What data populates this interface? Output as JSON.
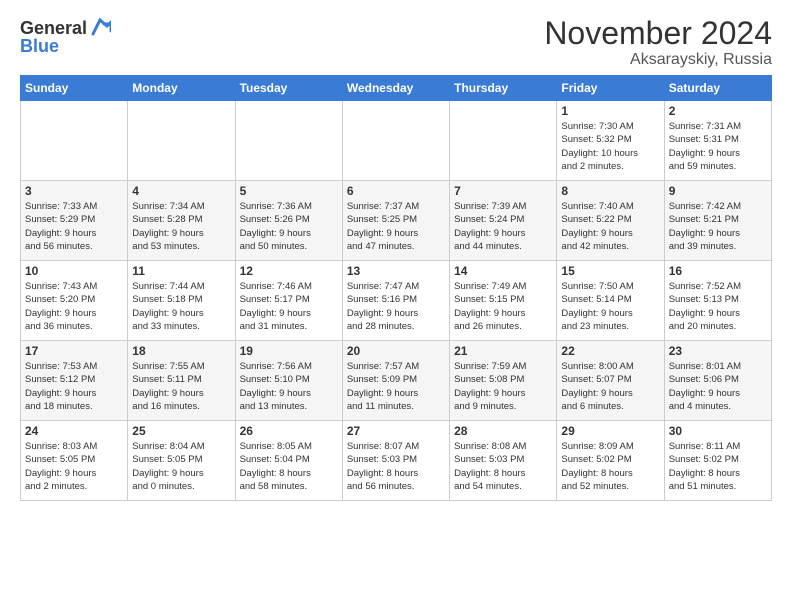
{
  "logo": {
    "general": "General",
    "blue": "Blue"
  },
  "header": {
    "month": "November 2024",
    "location": "Aksarayskiy, Russia"
  },
  "weekdays": [
    "Sunday",
    "Monday",
    "Tuesday",
    "Wednesday",
    "Thursday",
    "Friday",
    "Saturday"
  ],
  "weeks": [
    [
      {
        "day": "",
        "info": ""
      },
      {
        "day": "",
        "info": ""
      },
      {
        "day": "",
        "info": ""
      },
      {
        "day": "",
        "info": ""
      },
      {
        "day": "",
        "info": ""
      },
      {
        "day": "1",
        "info": "Sunrise: 7:30 AM\nSunset: 5:32 PM\nDaylight: 10 hours\nand 2 minutes."
      },
      {
        "day": "2",
        "info": "Sunrise: 7:31 AM\nSunset: 5:31 PM\nDaylight: 9 hours\nand 59 minutes."
      }
    ],
    [
      {
        "day": "3",
        "info": "Sunrise: 7:33 AM\nSunset: 5:29 PM\nDaylight: 9 hours\nand 56 minutes."
      },
      {
        "day": "4",
        "info": "Sunrise: 7:34 AM\nSunset: 5:28 PM\nDaylight: 9 hours\nand 53 minutes."
      },
      {
        "day": "5",
        "info": "Sunrise: 7:36 AM\nSunset: 5:26 PM\nDaylight: 9 hours\nand 50 minutes."
      },
      {
        "day": "6",
        "info": "Sunrise: 7:37 AM\nSunset: 5:25 PM\nDaylight: 9 hours\nand 47 minutes."
      },
      {
        "day": "7",
        "info": "Sunrise: 7:39 AM\nSunset: 5:24 PM\nDaylight: 9 hours\nand 44 minutes."
      },
      {
        "day": "8",
        "info": "Sunrise: 7:40 AM\nSunset: 5:22 PM\nDaylight: 9 hours\nand 42 minutes."
      },
      {
        "day": "9",
        "info": "Sunrise: 7:42 AM\nSunset: 5:21 PM\nDaylight: 9 hours\nand 39 minutes."
      }
    ],
    [
      {
        "day": "10",
        "info": "Sunrise: 7:43 AM\nSunset: 5:20 PM\nDaylight: 9 hours\nand 36 minutes."
      },
      {
        "day": "11",
        "info": "Sunrise: 7:44 AM\nSunset: 5:18 PM\nDaylight: 9 hours\nand 33 minutes."
      },
      {
        "day": "12",
        "info": "Sunrise: 7:46 AM\nSunset: 5:17 PM\nDaylight: 9 hours\nand 31 minutes."
      },
      {
        "day": "13",
        "info": "Sunrise: 7:47 AM\nSunset: 5:16 PM\nDaylight: 9 hours\nand 28 minutes."
      },
      {
        "day": "14",
        "info": "Sunrise: 7:49 AM\nSunset: 5:15 PM\nDaylight: 9 hours\nand 26 minutes."
      },
      {
        "day": "15",
        "info": "Sunrise: 7:50 AM\nSunset: 5:14 PM\nDaylight: 9 hours\nand 23 minutes."
      },
      {
        "day": "16",
        "info": "Sunrise: 7:52 AM\nSunset: 5:13 PM\nDaylight: 9 hours\nand 20 minutes."
      }
    ],
    [
      {
        "day": "17",
        "info": "Sunrise: 7:53 AM\nSunset: 5:12 PM\nDaylight: 9 hours\nand 18 minutes."
      },
      {
        "day": "18",
        "info": "Sunrise: 7:55 AM\nSunset: 5:11 PM\nDaylight: 9 hours\nand 16 minutes."
      },
      {
        "day": "19",
        "info": "Sunrise: 7:56 AM\nSunset: 5:10 PM\nDaylight: 9 hours\nand 13 minutes."
      },
      {
        "day": "20",
        "info": "Sunrise: 7:57 AM\nSunset: 5:09 PM\nDaylight: 9 hours\nand 11 minutes."
      },
      {
        "day": "21",
        "info": "Sunrise: 7:59 AM\nSunset: 5:08 PM\nDaylight: 9 hours\nand 9 minutes."
      },
      {
        "day": "22",
        "info": "Sunrise: 8:00 AM\nSunset: 5:07 PM\nDaylight: 9 hours\nand 6 minutes."
      },
      {
        "day": "23",
        "info": "Sunrise: 8:01 AM\nSunset: 5:06 PM\nDaylight: 9 hours\nand 4 minutes."
      }
    ],
    [
      {
        "day": "24",
        "info": "Sunrise: 8:03 AM\nSunset: 5:05 PM\nDaylight: 9 hours\nand 2 minutes."
      },
      {
        "day": "25",
        "info": "Sunrise: 8:04 AM\nSunset: 5:05 PM\nDaylight: 9 hours\nand 0 minutes."
      },
      {
        "day": "26",
        "info": "Sunrise: 8:05 AM\nSunset: 5:04 PM\nDaylight: 8 hours\nand 58 minutes."
      },
      {
        "day": "27",
        "info": "Sunrise: 8:07 AM\nSunset: 5:03 PM\nDaylight: 8 hours\nand 56 minutes."
      },
      {
        "day": "28",
        "info": "Sunrise: 8:08 AM\nSunset: 5:03 PM\nDaylight: 8 hours\nand 54 minutes."
      },
      {
        "day": "29",
        "info": "Sunrise: 8:09 AM\nSunset: 5:02 PM\nDaylight: 8 hours\nand 52 minutes."
      },
      {
        "day": "30",
        "info": "Sunrise: 8:11 AM\nSunset: 5:02 PM\nDaylight: 8 hours\nand 51 minutes."
      }
    ]
  ]
}
